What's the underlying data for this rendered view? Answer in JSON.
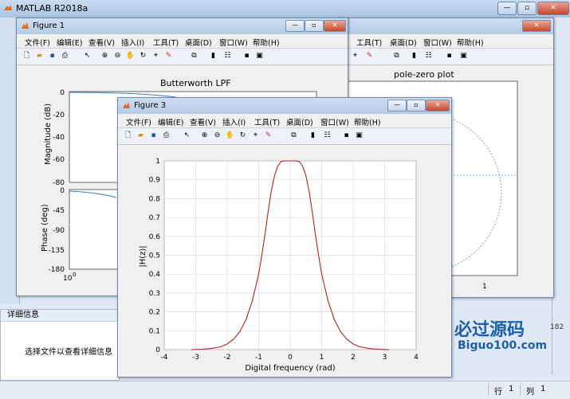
{
  "main": {
    "title": "MATLAB R2018a"
  },
  "details": {
    "header": "详细信息",
    "message": "选择文件以查看详细信息"
  },
  "status": {
    "row_label": "行",
    "row_value": "1",
    "col_label": "列",
    "col_value": "1"
  },
  "watermark": {
    "brand": "必过源码",
    "url": "Biguo100.com",
    "partial": "182"
  },
  "menus": [
    "文件(F)",
    "编辑(E)",
    "查看(V)",
    "插入(I)",
    "工具(T)",
    "桌面(D)",
    "窗口(W)",
    "帮助(H)"
  ],
  "menus_fig2": [
    "工具(T)",
    "桌面(D)",
    "窗口(W)",
    "帮助(H)"
  ],
  "fig1": {
    "title": "Figure 1",
    "plot_title": "Butterworth LPF",
    "mag_ylabel": "Magnitude (dB)",
    "mag_ticks": [
      "0",
      "-20",
      "-40",
      "-60",
      "-80"
    ],
    "phase_ylabel": "Phase (deg)",
    "phase_ticks": [
      "0",
      "-45",
      "-90",
      "-135",
      "-180"
    ],
    "x_tick_base": "10",
    "x_tick_exp": "0"
  },
  "fig2": {
    "title": "pole-zero plot",
    "x_tick": "1"
  },
  "fig3": {
    "title": "Figure 3"
  },
  "chart_data": {
    "type": "line",
    "title": "",
    "xlabel": "Digital frequency (rad)",
    "ylabel": "|H(z)|",
    "xlim": [
      -4,
      4
    ],
    "ylim": [
      0,
      1
    ],
    "grid": true,
    "xticks": [
      "-4",
      "-3",
      "-2",
      "-1",
      "0",
      "1",
      "2",
      "3",
      "4"
    ],
    "yticks": [
      "0",
      "0.1",
      "0.2",
      "0.3",
      "0.4",
      "0.5",
      "0.6",
      "0.7",
      "0.8",
      "0.9",
      "1"
    ],
    "color": "#b02020",
    "x": [
      -3.14,
      -2.8,
      -2.5,
      -2.2,
      -2.0,
      -1.8,
      -1.6,
      -1.4,
      -1.2,
      -1.0,
      -0.9,
      -0.8,
      -0.7,
      -0.6,
      -0.5,
      -0.4,
      -0.3,
      -0.2,
      -0.1,
      0,
      0.1,
      0.2,
      0.3,
      0.4,
      0.5,
      0.6,
      0.7,
      0.8,
      0.9,
      1.0,
      1.2,
      1.4,
      1.6,
      1.8,
      2.0,
      2.2,
      2.5,
      2.8,
      3.14
    ],
    "y": [
      0.0,
      0.002,
      0.006,
      0.015,
      0.03,
      0.055,
      0.095,
      0.16,
      0.26,
      0.4,
      0.5,
      0.61,
      0.73,
      0.84,
      0.92,
      0.97,
      0.995,
      1.0,
      1.0,
      1.0,
      1.0,
      1.0,
      0.995,
      0.97,
      0.92,
      0.84,
      0.73,
      0.61,
      0.5,
      0.4,
      0.26,
      0.16,
      0.095,
      0.055,
      0.03,
      0.015,
      0.006,
      0.002,
      0.0
    ]
  }
}
